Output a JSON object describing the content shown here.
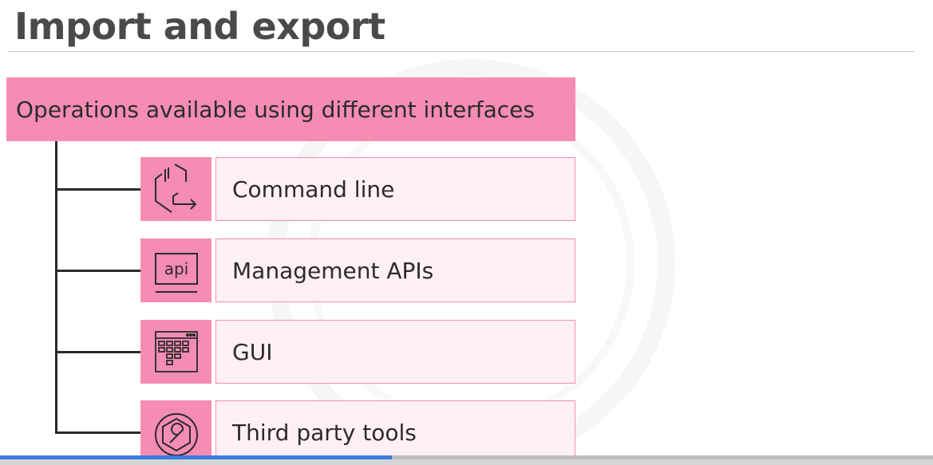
{
  "slide": {
    "title": "Import and export"
  },
  "diagram": {
    "header": "Operations available using different interfaces",
    "items": [
      {
        "label": "Command line",
        "icon": "command-line-icon"
      },
      {
        "label": "Management APIs",
        "icon": "api-icon",
        "icon_text": "api"
      },
      {
        "label": "GUI",
        "icon": "gui-window-icon"
      },
      {
        "label": "Third party tools",
        "icon": "wrench-hexagon-icon"
      }
    ]
  },
  "player": {
    "progress_fraction": 0.42
  },
  "colors": {
    "accent_pink": "#f58cb4",
    "label_background": "#fff0f5",
    "title_text": "#4a4a4a",
    "progress_blue": "#3d7be0"
  }
}
